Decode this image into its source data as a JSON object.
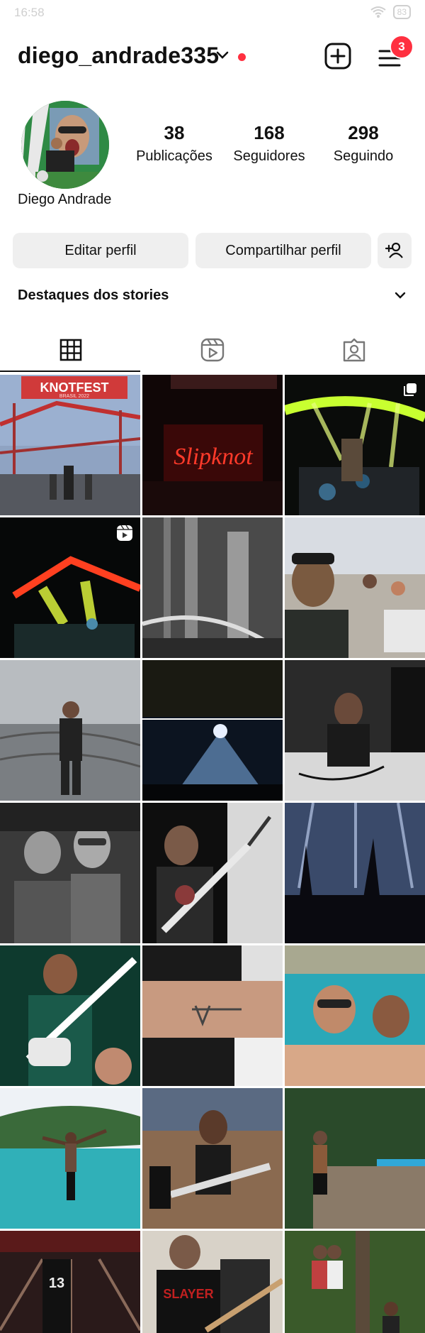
{
  "status_bar": {
    "time": "16:58",
    "battery": "83"
  },
  "header": {
    "username": "diego_andrade335",
    "notification_count": "3"
  },
  "profile": {
    "full_name": "Diego Andrade",
    "stats": [
      {
        "value": "38",
        "label": "Publicações"
      },
      {
        "value": "168",
        "label": "Seguidores"
      },
      {
        "value": "298",
        "label": "Seguindo"
      }
    ]
  },
  "buttons": {
    "edit": "Editar perfil",
    "share": "Compartilhar perfil"
  },
  "highlights": {
    "title": "Destaques dos stories"
  },
  "tabs": [
    "grid",
    "reels",
    "tagged"
  ],
  "banner_text": {
    "knotfest": "KNOTFEST",
    "knotfest_sub": "BRASIL 2022",
    "slipknot": "Slipknot",
    "slayer": "SLAYER",
    "jersey": "13"
  },
  "colors": {
    "accent_red": "#ff3040",
    "button_bg": "#efefef"
  }
}
